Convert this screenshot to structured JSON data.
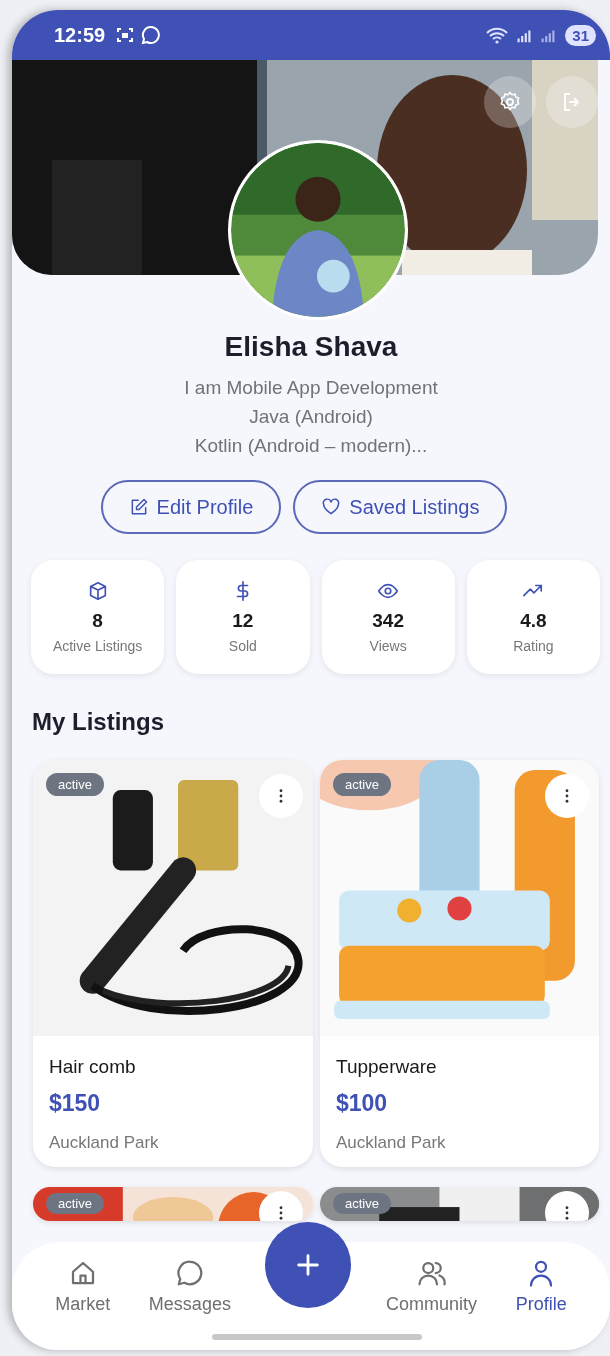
{
  "status_bar": {
    "time": "12:59",
    "battery": "31"
  },
  "profile": {
    "name": "Elisha Shava",
    "bio": [
      "I am Mobile App Development",
      "Java (Android)",
      "Kotlin (Android – modern)..."
    ]
  },
  "actions": [
    {
      "kind": "edit",
      "label": "Edit Profile"
    },
    {
      "kind": "saved",
      "label": "Saved Listings"
    }
  ],
  "stats": [
    {
      "kind": "box",
      "value": "8",
      "label": "Active Listings"
    },
    {
      "kind": "dollar",
      "value": "12",
      "label": "Sold"
    },
    {
      "kind": "eye",
      "value": "342",
      "label": "Views"
    },
    {
      "kind": "trend",
      "value": "4.8",
      "label": "Rating"
    }
  ],
  "section_title": "My Listings",
  "listings": [
    {
      "kind": "comb",
      "status": "active",
      "title": "Hair comb",
      "price": "$150",
      "location": "Auckland Park"
    },
    {
      "kind": "tubs",
      "status": "active",
      "title": "Tupperware",
      "price": "$100",
      "location": "Auckland Park"
    },
    {
      "kind": "bowls",
      "status": "active"
    },
    {
      "kind": "grey",
      "status": "active"
    }
  ],
  "nav": [
    {
      "kind": "home",
      "label": "Market",
      "selected": false
    },
    {
      "kind": "chat",
      "label": "Messages",
      "selected": false
    },
    {
      "kind": "add"
    },
    {
      "kind": "people",
      "label": "Community",
      "selected": false
    },
    {
      "kind": "person",
      "label": "Profile",
      "selected": true
    }
  ]
}
